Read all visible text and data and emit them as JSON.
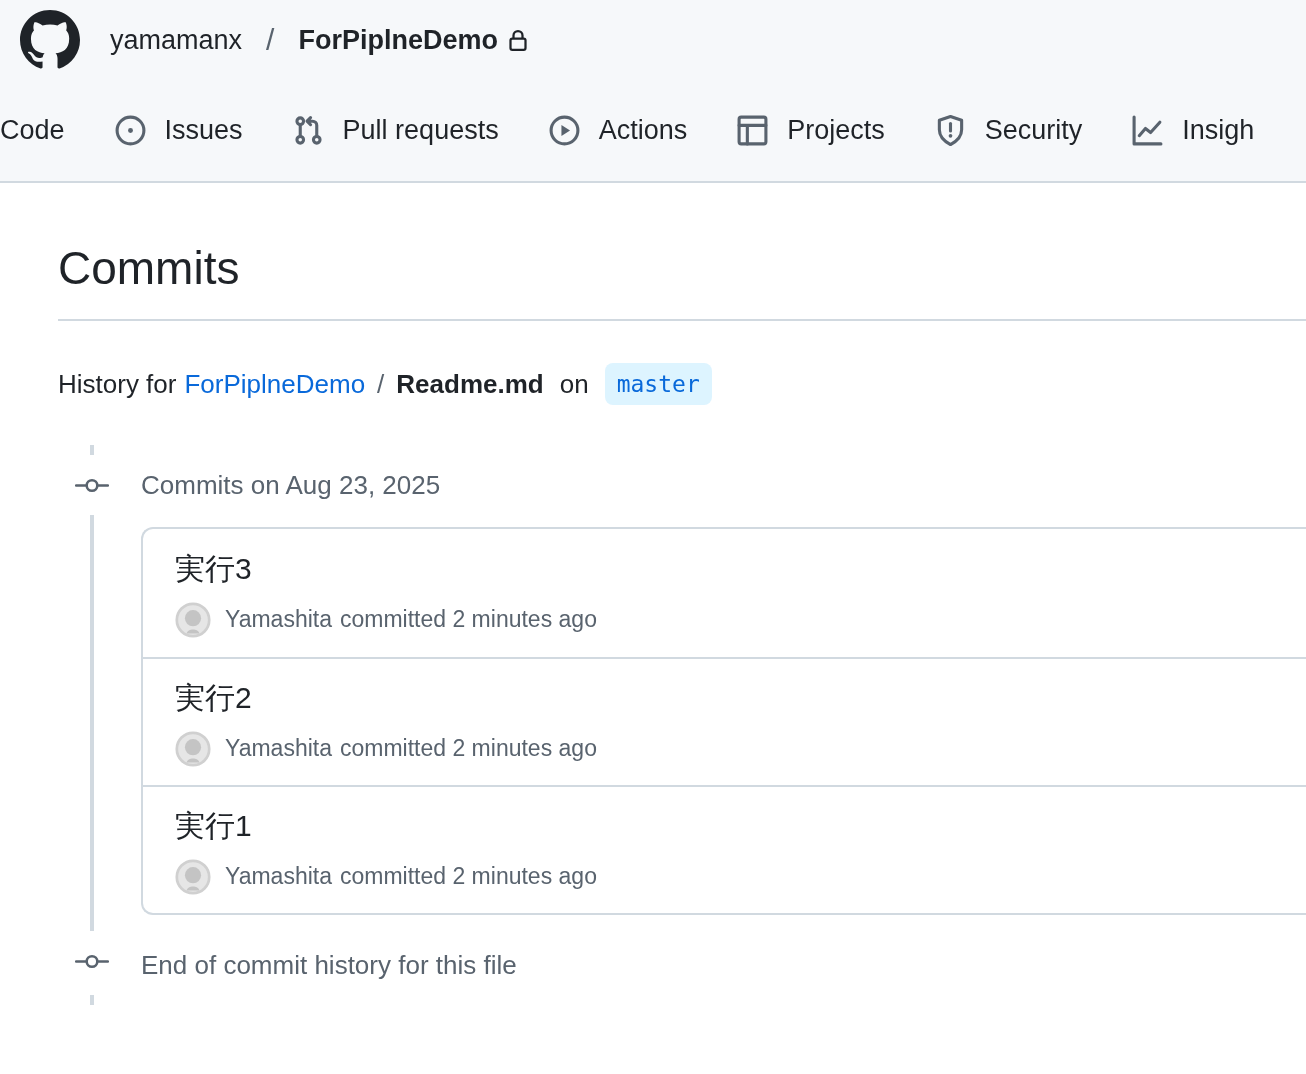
{
  "header": {
    "owner": "yamamanx",
    "separator": "/",
    "repo": "ForPiplneDemo",
    "private": true
  },
  "nav": [
    {
      "label": "Code",
      "kind": "plain",
      "selected": false
    },
    {
      "label": "Issues",
      "kind": "issues",
      "selected": false
    },
    {
      "label": "Pull requests",
      "kind": "pulls",
      "selected": false
    },
    {
      "label": "Actions",
      "kind": "actions",
      "selected": false
    },
    {
      "label": "Projects",
      "kind": "projects",
      "selected": false
    },
    {
      "label": "Security",
      "kind": "security",
      "selected": false
    },
    {
      "label": "Insigh",
      "kind": "insights",
      "selected": false
    }
  ],
  "page": {
    "title": "Commits"
  },
  "history": {
    "prefix": "History for",
    "repo_link": "ForPiplneDemo",
    "separator": "/",
    "file": "Readme.md",
    "on": "on",
    "branch": "master"
  },
  "groups": [
    {
      "heading": "Commits on Aug 23, 2025",
      "commits": [
        {
          "title": "実行3",
          "author": "Yamashita",
          "meta": "committed 2 minutes ago"
        },
        {
          "title": "実行2",
          "author": "Yamashita",
          "meta": "committed 2 minutes ago"
        },
        {
          "title": "実行1",
          "author": "Yamashita",
          "meta": "committed 2 minutes ago"
        }
      ]
    }
  ],
  "end_note": "End of commit history for this file"
}
